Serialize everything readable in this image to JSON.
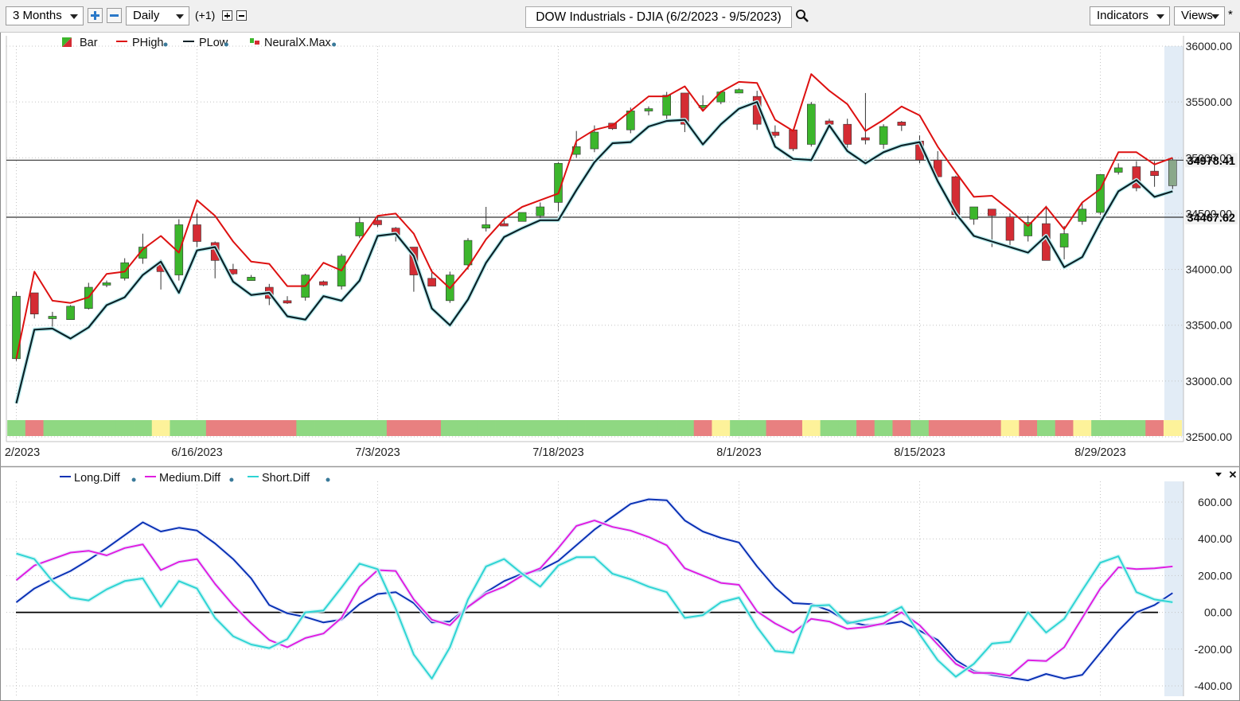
{
  "toolbar": {
    "period": "3 Months",
    "interval": "Daily",
    "offset": "(+1)",
    "title": "DOW Industrials - DJIA (6/2/2023 - 9/5/2023)",
    "indicators": "Indicators",
    "views": "Views",
    "star": "*"
  },
  "colors": {
    "up": "#3cb62c",
    "down": "#d42c34",
    "phigh": "#dd1111",
    "plow": "#0b2228",
    "long": "#0a32b4",
    "medium": "#e01ee0",
    "short": "#2ed4d4",
    "band_green": "#8fd882",
    "band_red": "#e88080",
    "band_yellow": "#fdf29a"
  },
  "chart_data": [
    {
      "type": "candlestick",
      "x_labels": [
        "2/2023",
        "6/16/2023",
        "7/3/2023",
        "7/18/2023",
        "8/1/2023",
        "8/15/2023",
        "8/29/2023"
      ],
      "x_label_index": [
        0,
        10,
        20,
        30,
        40,
        50,
        60
      ],
      "y_ticks": [
        "36000.00",
        "35500.00",
        "35000.00",
        "34500.00",
        "34000.00",
        "33500.00",
        "33000.00",
        "32500.00"
      ],
      "ylim": [
        32500,
        36000
      ],
      "legend": [
        "Bar",
        "PHigh",
        "PLow",
        "NeuralX.Max"
      ],
      "hlines": [
        {
          "value": 34978.41,
          "label": "34978.41"
        },
        {
          "value": 34467.62,
          "label": "34467.62"
        }
      ],
      "ohlc": [
        [
          33200,
          33800,
          33180,
          33760
        ],
        [
          33790,
          33780,
          33560,
          33600
        ],
        [
          33560,
          33620,
          33480,
          33580
        ],
        [
          33550,
          33680,
          33550,
          33670
        ],
        [
          33650,
          33880,
          33640,
          33840
        ],
        [
          33860,
          33900,
          33840,
          33880
        ],
        [
          33920,
          34100,
          33900,
          34060
        ],
        [
          34100,
          34320,
          34050,
          34200
        ],
        [
          34040,
          34090,
          33820,
          33980
        ],
        [
          33950,
          34450,
          33900,
          34400
        ],
        [
          34400,
          34500,
          34200,
          34250
        ],
        [
          34240,
          34250,
          33920,
          34080
        ],
        [
          34000,
          34050,
          33950,
          33960
        ],
        [
          33900,
          33950,
          33900,
          33930
        ],
        [
          33840,
          33870,
          33680,
          33740
        ],
        [
          33720,
          33760,
          33690,
          33700
        ],
        [
          33750,
          33960,
          33720,
          33950
        ],
        [
          33890,
          33900,
          33850,
          33860
        ],
        [
          33850,
          34140,
          33820,
          34120
        ],
        [
          34300,
          34470,
          34280,
          34420
        ],
        [
          34440,
          34480,
          34380,
          34400
        ],
        [
          34370,
          34380,
          34250,
          34310
        ],
        [
          34200,
          34200,
          33800,
          33950
        ],
        [
          33920,
          34000,
          33900,
          33850
        ],
        [
          33720,
          33980,
          33700,
          33950
        ],
        [
          34040,
          34280,
          34000,
          34260
        ],
        [
          34370,
          34560,
          34340,
          34400
        ],
        [
          34410,
          34440,
          34400,
          34400
        ],
        [
          34430,
          34500,
          34430,
          34510
        ],
        [
          34480,
          34600,
          34460,
          34560
        ],
        [
          34600,
          34960,
          34520,
          34950
        ],
        [
          35030,
          35240,
          35000,
          35100
        ],
        [
          35080,
          35290,
          35050,
          35230
        ],
        [
          35310,
          35300,
          35250,
          35260
        ],
        [
          35250,
          35450,
          35220,
          35420
        ],
        [
          35430,
          35460,
          35380,
          35440
        ],
        [
          35380,
          35590,
          35340,
          35560
        ],
        [
          35580,
          35580,
          35230,
          35300
        ],
        [
          35450,
          35560,
          35430,
          35470
        ],
        [
          35500,
          35600,
          35480,
          35590
        ],
        [
          35580,
          35620,
          35590,
          35610
        ],
        [
          35550,
          35600,
          35250,
          35300
        ],
        [
          35230,
          35290,
          35180,
          35200
        ],
        [
          35250,
          35260,
          35060,
          35080
        ],
        [
          35120,
          35500,
          35100,
          35480
        ],
        [
          35330,
          35350,
          35280,
          35300
        ],
        [
          35300,
          35350,
          35060,
          35120
        ],
        [
          35180,
          35580,
          35120,
          35170
        ],
        [
          35120,
          35300,
          35080,
          35280
        ],
        [
          35320,
          35330,
          35240,
          35290
        ],
        [
          35150,
          35200,
          34950,
          34980
        ],
        [
          34980,
          35060,
          34820,
          34830
        ],
        [
          34830,
          34840,
          34450,
          34490
        ],
        [
          34450,
          34550,
          34400,
          34560
        ],
        [
          34540,
          34540,
          34200,
          34480
        ],
        [
          34470,
          34500,
          34200,
          34260
        ],
        [
          34300,
          34480,
          34250,
          34420
        ],
        [
          34410,
          34570,
          34100,
          34080
        ],
        [
          34200,
          34390,
          34090,
          34320
        ],
        [
          34430,
          34600,
          34400,
          34540
        ],
        [
          34510,
          34840,
          34490,
          34850
        ],
        [
          34870,
          34950,
          34850,
          34910
        ],
        [
          34920,
          34970,
          34700,
          34730
        ],
        [
          34880,
          34970,
          34740,
          34840
        ],
        [
          34750,
          35000,
          34720,
          34980
        ]
      ],
      "phigh": [
        33200,
        33980,
        33720,
        33700,
        33750,
        33960,
        33980,
        34180,
        34300,
        34150,
        34620,
        34480,
        34250,
        34070,
        34050,
        33850,
        33850,
        34060,
        33990,
        34250,
        34480,
        34500,
        34320,
        33980,
        33830,
        34020,
        34270,
        34450,
        34560,
        34620,
        34680,
        35150,
        35250,
        35290,
        35420,
        35550,
        35550,
        35640,
        35420,
        35590,
        35680,
        35670,
        35340,
        35240,
        35750,
        35600,
        35480,
        35240,
        35340,
        35460,
        35380,
        35100,
        34870,
        34650,
        34660,
        34530,
        34390,
        34560,
        34360,
        34600,
        34720,
        35050,
        35050,
        34940,
        35000
      ],
      "plow": [
        32800,
        33460,
        33470,
        33380,
        33480,
        33680,
        33750,
        33950,
        34070,
        33790,
        34170,
        34200,
        33890,
        33770,
        33790,
        33580,
        33550,
        33760,
        33720,
        33900,
        34300,
        34320,
        34120,
        33650,
        33500,
        33730,
        34060,
        34290,
        34370,
        34440,
        34440,
        34710,
        34960,
        35130,
        35140,
        35280,
        35330,
        35340,
        35120,
        35300,
        35440,
        35500,
        35100,
        34990,
        34980,
        35290,
        35060,
        34950,
        35050,
        35110,
        35140,
        34790,
        34500,
        34300,
        34250,
        34200,
        34150,
        34300,
        34020,
        34110,
        34420,
        34700,
        34800,
        34650,
        34700
      ],
      "signal_band": [
        "g",
        "r",
        "g",
        "g",
        "g",
        "g",
        "g",
        "g",
        "y",
        "g",
        "g",
        "r",
        "r",
        "r",
        "r",
        "r",
        "g",
        "g",
        "g",
        "g",
        "g",
        "r",
        "r",
        "r",
        "g",
        "g",
        "g",
        "g",
        "g",
        "g",
        "g",
        "g",
        "g",
        "g",
        "g",
        "g",
        "g",
        "g",
        "r",
        "y",
        "g",
        "g",
        "r",
        "r",
        "y",
        "g",
        "g",
        "r",
        "g",
        "r",
        "g",
        "r",
        "r",
        "r",
        "r",
        "y",
        "r",
        "g",
        "r",
        "y",
        "g",
        "g",
        "g",
        "r",
        "y"
      ]
    },
    {
      "type": "line",
      "legend": [
        "Long.Diff",
        "Medium.Diff",
        "Short.Diff"
      ],
      "y_ticks": [
        "600.00",
        "400.00",
        "200.00",
        "00.00",
        "-200.00",
        "-400.00"
      ],
      "ylim": [
        -400,
        600
      ],
      "series": [
        {
          "name": "Long.Diff",
          "values": [
            55,
            130,
            180,
            225,
            285,
            350,
            420,
            490,
            440,
            460,
            445,
            375,
            290,
            185,
            40,
            -5,
            -25,
            -55,
            -40,
            45,
            100,
            110,
            50,
            -55,
            -50,
            30,
            110,
            170,
            210,
            230,
            280,
            365,
            450,
            520,
            590,
            615,
            610,
            500,
            440,
            405,
            380,
            250,
            135,
            50,
            45,
            10,
            -50,
            -70,
            -65,
            -50,
            -100,
            -150,
            -260,
            -320,
            -340,
            -355,
            -370,
            -335,
            -360,
            -340,
            -220,
            -100,
            0,
            40,
            105
          ]
        },
        {
          "name": "Medium.Diff",
          "values": [
            175,
            255,
            290,
            325,
            335,
            310,
            350,
            370,
            230,
            275,
            290,
            155,
            40,
            -60,
            -150,
            -190,
            -140,
            -115,
            -30,
            140,
            230,
            225,
            70,
            -40,
            -70,
            30,
            100,
            140,
            200,
            240,
            350,
            470,
            500,
            465,
            445,
            410,
            365,
            240,
            200,
            160,
            150,
            5,
            -60,
            -110,
            -35,
            -50,
            -90,
            -80,
            -60,
            0,
            -70,
            -175,
            -280,
            -330,
            -330,
            -345,
            -260,
            -265,
            -190,
            -30,
            130,
            245,
            235,
            240,
            250
          ]
        },
        {
          "name": "Short.Diff",
          "values": [
            320,
            290,
            170,
            80,
            65,
            125,
            170,
            185,
            30,
            170,
            130,
            -30,
            -130,
            -175,
            -195,
            -145,
            0,
            10,
            135,
            265,
            235,
            20,
            -230,
            -360,
            -190,
            70,
            250,
            290,
            210,
            140,
            255,
            300,
            300,
            210,
            180,
            140,
            110,
            -30,
            -15,
            55,
            80,
            -80,
            -210,
            -220,
            35,
            40,
            -60,
            -40,
            -20,
            30,
            -120,
            -260,
            -350,
            -280,
            -170,
            -160,
            0,
            -110,
            -35,
            120,
            270,
            305,
            110,
            70,
            55
          ]
        }
      ]
    }
  ]
}
